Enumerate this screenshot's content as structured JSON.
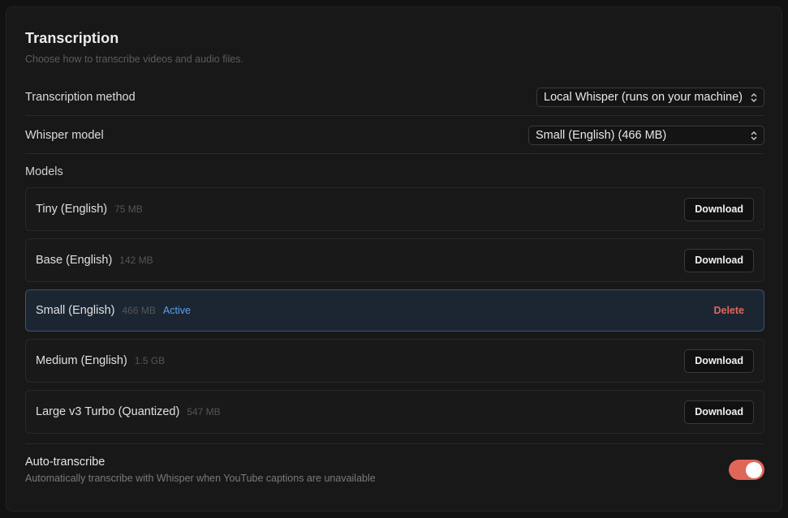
{
  "section": {
    "title": "Transcription",
    "subtitle": "Choose how to transcribe videos and audio files."
  },
  "method": {
    "label": "Transcription method",
    "value": "Local Whisper (runs on your machine)"
  },
  "whisper": {
    "label": "Whisper model",
    "value": "Small (English) (466 MB)"
  },
  "models": {
    "label": "Models",
    "items": [
      {
        "name": "Tiny (English)",
        "size": "75 MB",
        "action": "Download"
      },
      {
        "name": "Base (English)",
        "size": "142 MB",
        "action": "Download"
      },
      {
        "name": "Small (English)",
        "size": "466 MB",
        "status": "Active",
        "action": "Delete"
      },
      {
        "name": "Medium (English)",
        "size": "1.5 GB",
        "action": "Download"
      },
      {
        "name": "Large v3 Turbo (Quantized)",
        "size": "547 MB",
        "action": "Download"
      }
    ]
  },
  "auto_transcribe": {
    "title": "Auto-transcribe",
    "description": "Automatically transcribe with Whisper when YouTube captions are unavailable",
    "enabled": true
  },
  "colors": {
    "accent": "#e0665a",
    "active_badge": "#5aa2e8",
    "active_card_bg": "#1c2633"
  }
}
